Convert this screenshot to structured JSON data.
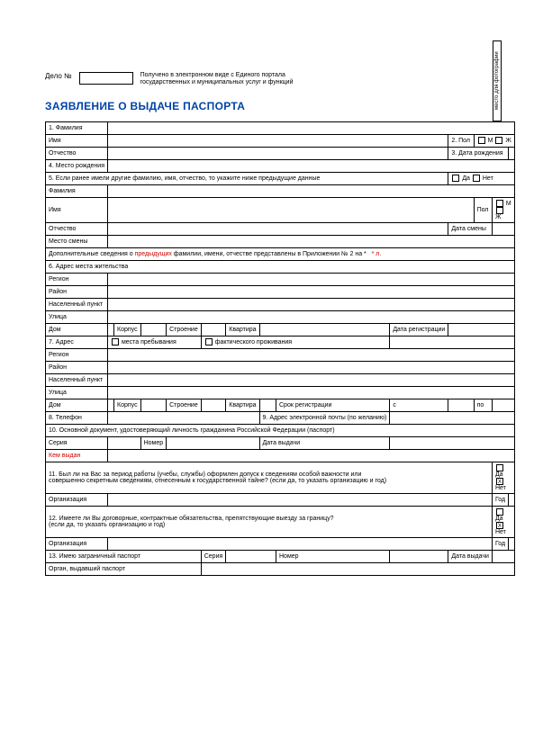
{
  "topbar": {
    "delo_label": "Дело №",
    "received_line1": "Получено в электронном виде с Единого портала",
    "received_line2": "государственных и муниципальных услуг и функций",
    "photo_label": "место для фотографии"
  },
  "title": "ЗАЯВЛЕНИЕ О ВЫДАЧЕ ПАСПОРТА",
  "s1": {
    "surname": "1. Фамилия",
    "name": "Имя",
    "sex": "2. Пол",
    "m": "М",
    "f": "Ж",
    "patr": "Отчество",
    "dob": "3. Дата рождения",
    "pob": "4. Место рождения"
  },
  "s5": {
    "q": "5. Если ранее имели другие фамилию, имя, отчество, то укажите ниже предыдущие данные",
    "yes": "Да",
    "no": "Нет",
    "surname": "Фамилия",
    "name": "Имя",
    "sex": "Пол",
    "m": "М",
    "f": "Ж",
    "patr": "Отчество",
    "chdate": "Дата смены",
    "chplace": "Место смены",
    "note_a": "Дополнительные сведения о",
    "note_b": "предыдущих",
    "note_c": "фамилии, имени, отчестве представлены в Приложении № 2 на *",
    "note_d": "* л."
  },
  "s6": {
    "h": "6. Адрес места жительства",
    "region": "Регион",
    "district": "Район",
    "locality": "Населенный пункт",
    "street": "Улица",
    "house": "Дом",
    "building": "Корпус",
    "struct": "Строение",
    "apt": "Квартира",
    "regdate": "Дата регистрации"
  },
  "s7": {
    "h": "7. Адрес",
    "stay": "места пребывания",
    "actual": "фактического проживания",
    "region": "Регион",
    "district": "Район",
    "locality": "Населенный пункт",
    "street": "Улица",
    "house": "Дом",
    "building": "Корпус",
    "struct": "Строение",
    "apt": "Квартира",
    "regperiod": "Срок регистрации",
    "from": "с",
    "to": "по"
  },
  "s8": {
    "phone": "8. Телефон",
    "email": "9. Адрес электронной почты (по желанию)"
  },
  "s10": {
    "h": "10. Основной документ, удостоверяющий личность гражданина Российской Федерации (паспорт)",
    "series": "Серия",
    "number": "Номер",
    "date": "Дата выдачи",
    "issuer": "Кем выдан"
  },
  "s11": {
    "q1": "11. Был ли на Вас за период работы (учебы, службы) оформлен допуск к сведениям особой важности или",
    "q2": "совершенно секретным сведениям, отнесенным к государственной тайне? (если да, то указать организацию и год)",
    "yes": "Да",
    "no": "Нет",
    "org": "Организация",
    "year": "Год"
  },
  "s12": {
    "q1": "12. Имеете ли Вы договорные, контрактные обязательства, препятствующие выезду за границу?",
    "q2": "(если да, то указать организацию и год)",
    "yes": "Да",
    "no": "Нет",
    "org": "Организация",
    "year": "Год"
  },
  "s13": {
    "h": "13. Имею заграничный паспорт",
    "series": "Серия",
    "number": "Номер",
    "date": "Дата выдачи",
    "issuer": "Орган, выдавший паспорт"
  }
}
